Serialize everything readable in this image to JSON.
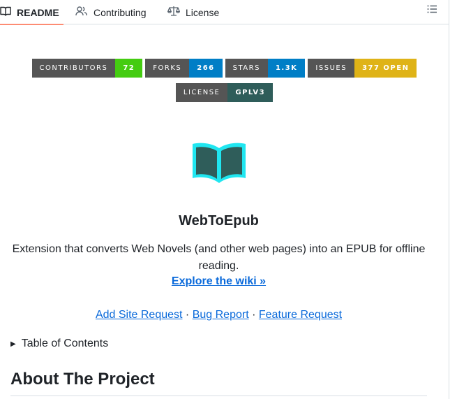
{
  "tabs": [
    {
      "label": "README",
      "active": true,
      "icon": "book-icon"
    },
    {
      "label": "Contributing",
      "icon": "people-icon"
    },
    {
      "label": "License",
      "icon": "law-scale-icon"
    }
  ],
  "toc_button_icon": "list-unordered-icon",
  "badges": [
    {
      "label": "CONTRIBUTORS",
      "value": "72",
      "color": "#4c1"
    },
    {
      "label": "FORKS",
      "value": "266",
      "color": "#007ec6"
    },
    {
      "label": "STARS",
      "value": "1.3K",
      "color": "#007ec6"
    },
    {
      "label": "ISSUES",
      "value": "377 OPEN",
      "color": "#dfb317"
    },
    {
      "label": "LICENSE",
      "value": "GPLV3",
      "color": "#2f5d5a"
    }
  ],
  "logo": {
    "icon": "open-book-icon",
    "glow_color": "#20e6f0",
    "fill_color": "#2f5d5a"
  },
  "title": "WebToEpub",
  "description": "Extension that converts Web Novels (and other web pages) into an EPUB for offline reading.",
  "wiki_link": "Explore the wiki »",
  "links": [
    "Add Site Request",
    "Bug Report",
    "Feature Request"
  ],
  "link_separator": "·",
  "toc_summary": "Table of Contents",
  "section_heading": "About The Project"
}
